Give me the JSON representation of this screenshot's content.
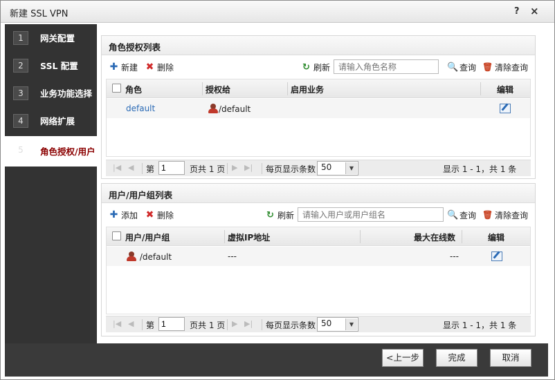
{
  "window": {
    "title": "新建 SSL VPN",
    "help": "?",
    "close": "×"
  },
  "steps": [
    {
      "num": "1",
      "label": "网关配置"
    },
    {
      "num": "2",
      "label": "SSL 配置"
    },
    {
      "num": "3",
      "label": "业务功能选择"
    },
    {
      "num": "4",
      "label": "网络扩展"
    },
    {
      "num": "5",
      "label": "角色授权/用户"
    }
  ],
  "role_panel": {
    "title": "角色授权列表",
    "new_label": "新建",
    "delete_label": "删除",
    "refresh_label": "刷新",
    "search_placeholder": "请输入角色名称",
    "query_label": "查询",
    "clear_label": "清除查询",
    "columns": [
      "角色",
      "授权给",
      "启用业务",
      "编辑"
    ],
    "rows": [
      {
        "role": "default",
        "grant": "/default",
        "services": ""
      }
    ],
    "pager": {
      "page_prefix": "第",
      "page": "1",
      "page_suffix": "页共 1 页",
      "per_page_label": "每页显示条数",
      "per_page": "50",
      "summary": "显示 1 - 1，共 1 条"
    }
  },
  "user_panel": {
    "title": "用户/用户组列表",
    "add_label": "添加",
    "delete_label": "删除",
    "refresh_label": "刷新",
    "search_placeholder": "请输入用户或用户组名",
    "query_label": "查询",
    "clear_label": "清除查询",
    "columns": [
      "用户/用户组",
      "虚拟IP地址",
      "最大在线数",
      "编辑"
    ],
    "rows": [
      {
        "user": "/default",
        "vip": "---",
        "max_online": "---"
      }
    ],
    "pager": {
      "page_prefix": "第",
      "page": "1",
      "page_suffix": "页共 1 页",
      "per_page_label": "每页显示条数",
      "per_page": "50",
      "summary": "显示 1 - 1，共 1 条"
    }
  },
  "footer": {
    "prev": "<上一步",
    "finish": "完成",
    "cancel": "取消"
  }
}
